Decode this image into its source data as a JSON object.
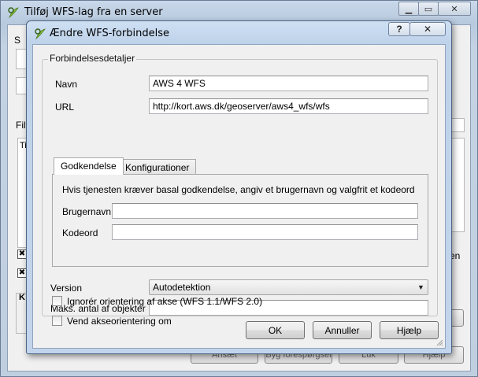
{
  "background_window": {
    "title": "Tilføj WFS-lag fra en server",
    "fragments": {
      "filter_label": "Filt",
      "table_header": "Ti",
      "right_frag": "en",
      "side_s1": "S",
      "side_s2": "S",
      "group_k": "K"
    },
    "buttons": [
      "Ansæt",
      "Byg forespørgsel",
      "Luk",
      "Hjælp"
    ]
  },
  "dialog": {
    "title": "Ændre WFS-forbindelse",
    "help_glyph": "?",
    "close_glyph": "✕",
    "group_title": "Forbindelsesdetaljer",
    "name": {
      "label": "Navn",
      "value": "AWS 4 WFS"
    },
    "url": {
      "label": "URL",
      "value": "http://kort.aws.dk/geoserver/aws4_wfs/wfs"
    },
    "tabs": [
      {
        "label": "Godkendelse",
        "active": true
      },
      {
        "label": "Konfigurationer",
        "active": false
      }
    ],
    "auth": {
      "info": "Hvis tjenesten kræver basal godkendelse, angiv et brugernavn og valgfrit et kodeord",
      "username_label": "Brugernavn",
      "username_value": "",
      "password_label": "Kodeord",
      "password_value": ""
    },
    "version": {
      "label": "Version",
      "selected": "Autodetektion"
    },
    "max_features": {
      "label": "Maks. antal af objekter",
      "value": ""
    },
    "ignore_axis": {
      "label": "Ignorér orientering af akse (WFS 1.1/WFS 2.0)",
      "checked": false
    },
    "invert_axis": {
      "label": "Vend akseorientering om",
      "checked": false
    },
    "buttons": {
      "ok": "OK",
      "cancel": "Annuller",
      "help": "Hjælp"
    }
  },
  "colors": {
    "titlebar": "#c2d5ec",
    "client_bg": "#f0f0f0",
    "field_border": "#abadb3"
  }
}
